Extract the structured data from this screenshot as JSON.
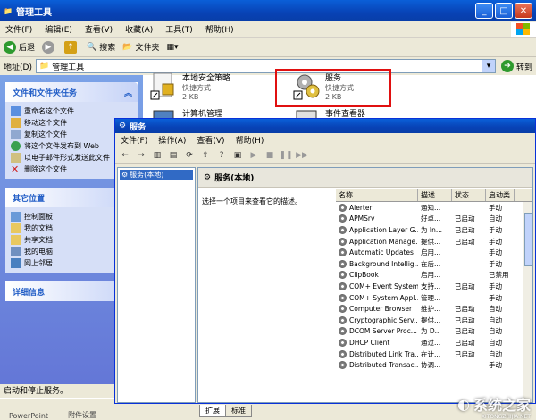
{
  "explorer": {
    "title": "管理工具",
    "menu": [
      "文件(F)",
      "编辑(E)",
      "查看(V)",
      "收藏(A)",
      "工具(T)",
      "帮助(H)"
    ],
    "toolbar": {
      "back": "后退",
      "search": "搜索",
      "folders": "文件夹"
    },
    "address": {
      "label": "地址(D)",
      "value": "管理工具",
      "go": "转到"
    },
    "tasks": {
      "file_tasks_title": "文件和文件夹任务",
      "file_tasks": [
        "重命名这个文件",
        "移动这个文件",
        "复制这个文件",
        "将这个文件发布到 Web",
        "以电子邮件形式发送此文件",
        "删除这个文件"
      ],
      "other_title": "其它位置",
      "other": [
        "控制面板",
        "我的文档",
        "共享文档",
        "我的电脑",
        "网上邻居"
      ],
      "details_title": "详细信息"
    },
    "files": [
      {
        "name": "本地安全策略",
        "type": "快捷方式",
        "size": "2 KB"
      },
      {
        "name": "服务",
        "type": "快捷方式",
        "size": "2 KB"
      },
      {
        "name": "计算机管理",
        "type": "",
        "size": ""
      },
      {
        "name": "事件查看器",
        "type": "",
        "size": ""
      }
    ],
    "status": "启动和停止服务。",
    "taskbar": [
      "PowerPoint",
      "附件设置"
    ]
  },
  "services": {
    "title": "服务",
    "menu": [
      "文件(F)",
      "操作(A)",
      "查看(V)",
      "帮助(H)"
    ],
    "tree_item": "服务(本地)",
    "header": "服务(本地)",
    "description": "选择一个项目来查看它的描述。",
    "columns": [
      "名称",
      "描述",
      "状态",
      "启动类"
    ],
    "rows": [
      {
        "name": "Alerter",
        "desc": "通知...",
        "status": "",
        "type": "手动"
      },
      {
        "name": "APMSrv",
        "desc": "好卓...",
        "status": "已启动",
        "type": "自动"
      },
      {
        "name": "Application Layer G...",
        "desc": "为 In...",
        "status": "已启动",
        "type": "手动"
      },
      {
        "name": "Application Manage...",
        "desc": "提供...",
        "status": "已启动",
        "type": "手动"
      },
      {
        "name": "Automatic Updates",
        "desc": "启用...",
        "status": "",
        "type": "手动"
      },
      {
        "name": "Background Intellig...",
        "desc": "在后...",
        "status": "",
        "type": "手动"
      },
      {
        "name": "ClipBook",
        "desc": "启用...",
        "status": "",
        "type": "已禁用"
      },
      {
        "name": "COM+ Event System",
        "desc": "支持...",
        "status": "已启动",
        "type": "手动"
      },
      {
        "name": "COM+ System Appl...",
        "desc": "管理...",
        "status": "",
        "type": "手动"
      },
      {
        "name": "Computer Browser",
        "desc": "维护...",
        "status": "已启动",
        "type": "自动"
      },
      {
        "name": "Cryptographic Serv...",
        "desc": "提供...",
        "status": "已启动",
        "type": "自动"
      },
      {
        "name": "DCOM Server Proc...",
        "desc": "为 D...",
        "status": "已启动",
        "type": "自动"
      },
      {
        "name": "DHCP Client",
        "desc": "通过...",
        "status": "已启动",
        "type": "自动"
      },
      {
        "name": "Distributed Link Tra...",
        "desc": "在计...",
        "status": "已启动",
        "type": "自动"
      },
      {
        "name": "Distributed Transac...",
        "desc": "协调...",
        "status": "",
        "type": "手动"
      }
    ],
    "tabs": [
      "扩展",
      "标准"
    ]
  },
  "watermark": {
    "text": "系统之家",
    "url": "XITONGZHIJIA.NET"
  },
  "colors": {
    "accent": "#0842b5",
    "highlight": "#e01010",
    "taskpane": "#6375d6"
  }
}
